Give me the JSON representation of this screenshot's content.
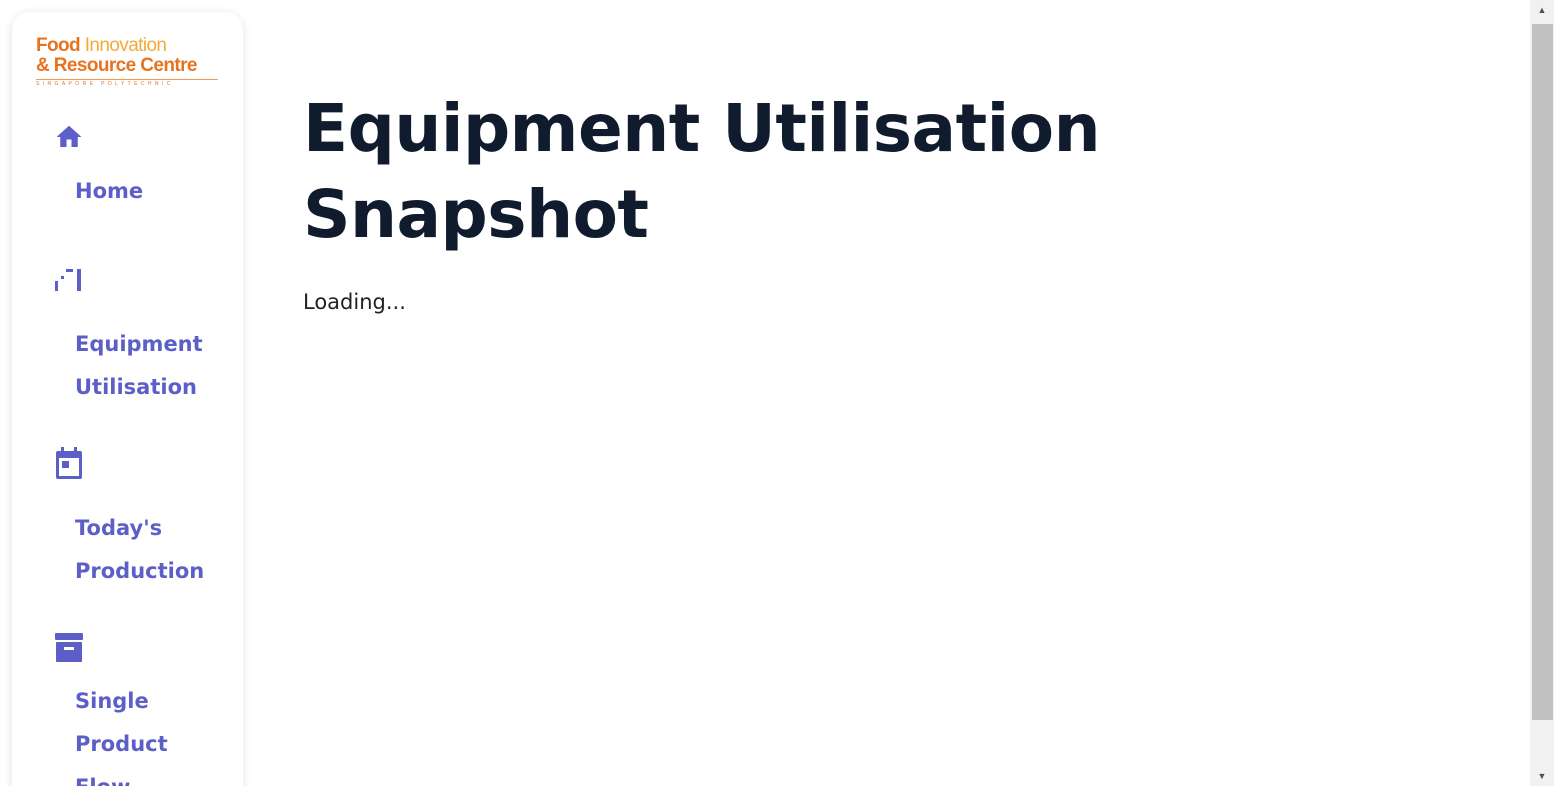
{
  "logo": {
    "line1_part1": "Food",
    "line1_part2": "Innovation",
    "line2": "& Resource Centre",
    "tagline": "SINGAPORE POLYTECHNIC"
  },
  "sidebar": {
    "items": [
      {
        "label": "Home",
        "icon": "home-icon"
      },
      {
        "label": "Equipment Utilisation",
        "icon": "bar-chart-icon"
      },
      {
        "label": "Today's Production",
        "icon": "calendar-icon"
      },
      {
        "label": "Single Product Flow",
        "icon": "archive-icon"
      }
    ]
  },
  "main": {
    "title": "Equipment Utilisation Snapshot",
    "status": "Loading..."
  },
  "colors": {
    "accent": "#5b5fc7",
    "title": "#111b2e",
    "logo_orange": "#e8731f",
    "logo_yellow": "#f3a93a"
  },
  "scrollbar": {
    "up_arrow": "▲",
    "down_arrow": "▼"
  }
}
